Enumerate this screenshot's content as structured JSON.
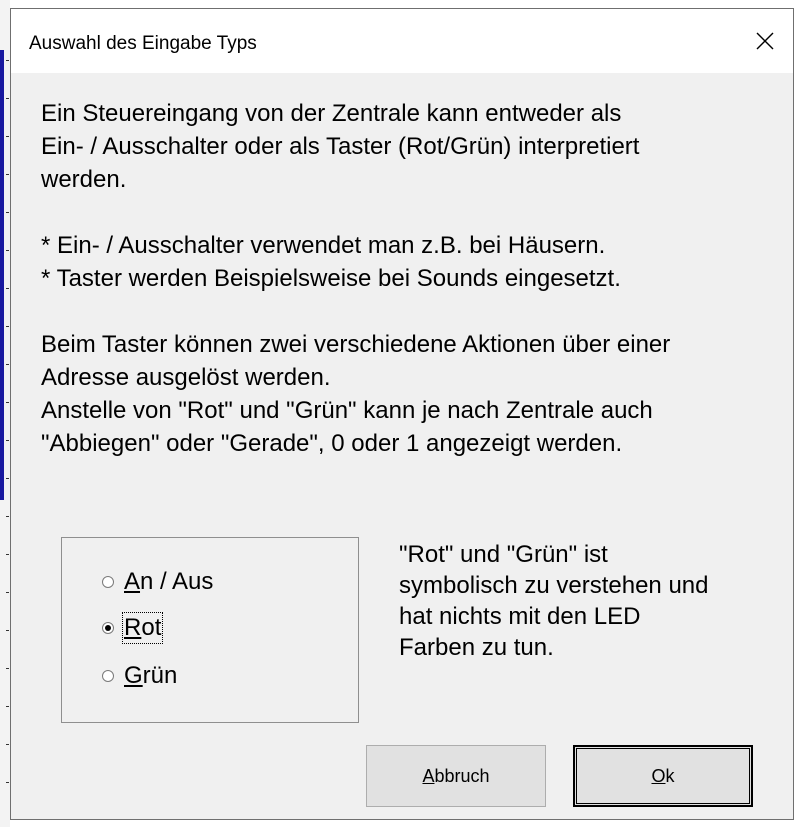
{
  "dialog": {
    "title": "Auswahl des Eingabe Typs",
    "close_glyph": "✕"
  },
  "description": {
    "lines_para1": [
      "Ein Steuereingang von der Zentrale kann entweder als",
      "Ein- / Ausschalter oder als Taster (Rot/Grün) interpretiert",
      "werden."
    ],
    "lines_para2": [
      "* Ein- / Ausschalter verwendet man z.B. bei Häusern.",
      "* Taster werden Beispielsweise bei Sounds eingesetzt."
    ],
    "lines_para3": [
      "Beim Taster können zwei verschiedene Aktionen über einer",
      "Adresse ausgelöst werden.",
      "Anstelle von \"Rot\" und \"Grün\" kann je nach Zentrale auch",
      "\"Abbiegen\" oder \"Gerade\", 0 oder 1 angezeigt werden."
    ]
  },
  "options": {
    "an_aus": {
      "accel": "A",
      "rest": "n / Aus",
      "checked": false
    },
    "rot": {
      "accel": "R",
      "rest": "ot",
      "checked": true
    },
    "gruen": {
      "accel": "G",
      "rest": "rün",
      "checked": false
    }
  },
  "note": {
    "lines": [
      "\"Rot\" und \"Grün\" ist",
      "symbolisch zu verstehen und",
      "hat nichts mit den LED",
      "Farben zu tun."
    ]
  },
  "buttons": {
    "cancel": {
      "accel": "A",
      "rest": "bbruch"
    },
    "ok": {
      "accel": "O",
      "rest": "k"
    }
  },
  "colors": {
    "dialog_bg": "#f0f0f0",
    "titlebar_bg": "#ffffff",
    "button_bg": "#e1e1e1",
    "left_accent": "#1a1aa0"
  }
}
